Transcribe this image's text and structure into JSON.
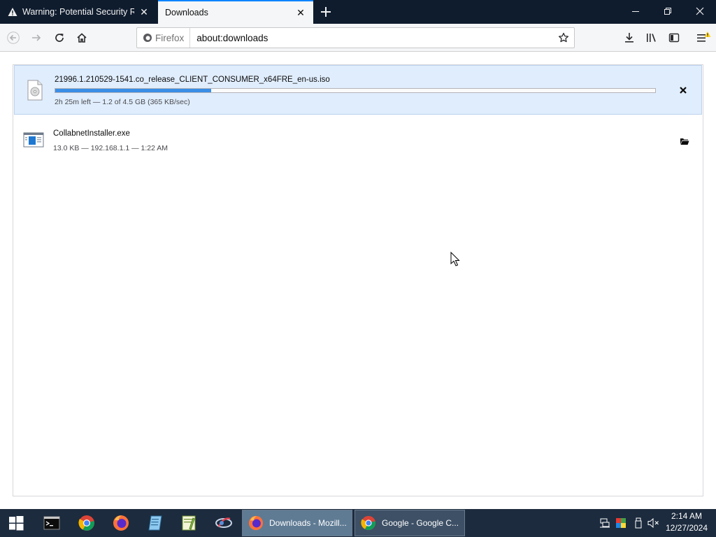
{
  "tabs": [
    {
      "title": "Warning: Potential Security Risk",
      "icon": "warning-icon",
      "active": false
    },
    {
      "title": "Downloads",
      "icon": "",
      "active": true
    }
  ],
  "navbar": {
    "identity_label": "Firefox",
    "url": "about:downloads"
  },
  "downloads": [
    {
      "name": "21996.1.210529-1541.co_release_CLIENT_CONSUMER_x64FRE_en-us.iso",
      "status": "2h 25m left — 1.2 of 4.5 GB (365 KB/sec)",
      "progress": 0.26,
      "icon": "disc-file-icon",
      "action": "cancel"
    },
    {
      "name": "CollabnetInstaller.exe",
      "status": "13.0 KB — 192.168.1.1 — 1:22 AM",
      "icon": "installer-file-icon",
      "action": "open-folder"
    }
  ],
  "taskbar": {
    "pinned": [
      "start-icon",
      "terminal-icon",
      "chrome-icon",
      "firefox-icon",
      "notepad-icon",
      "notepadpp-icon",
      "app-icon"
    ],
    "tasks": [
      {
        "label": "Downloads - Mozill...",
        "icon": "firefox-icon",
        "active": true
      },
      {
        "label": "Google - Google C...",
        "icon": "chrome-icon",
        "active": false
      }
    ],
    "clock": {
      "time": "2:14 AM",
      "date": "12/27/2024"
    }
  },
  "colors": {
    "tabstrip": "#0f1c2e",
    "accent": "#0a84ff",
    "progress_fill": "#3a8ee6",
    "selected_row": "#e0edfc",
    "taskbar": "#1c2b3e"
  }
}
